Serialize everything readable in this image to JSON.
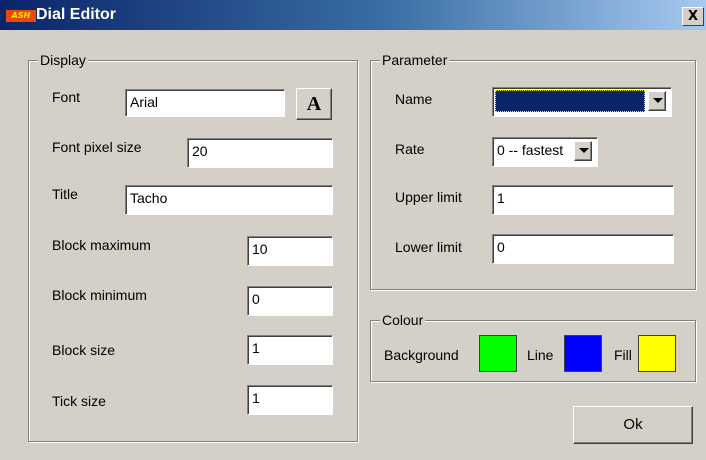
{
  "window": {
    "title": "Dial Editor",
    "logo_text": "ASH",
    "close_label": "X"
  },
  "display": {
    "legend": "Display",
    "font_label": "Font",
    "font_value": "Arial",
    "font_button_label": "A",
    "font_pixel_size_label": "Font pixel size",
    "font_pixel_size_value": "20",
    "title_label": "Title",
    "title_value": "Tacho",
    "block_maximum_label": "Block maximum",
    "block_maximum_value": "10",
    "block_minimum_label": "Block minimum",
    "block_minimum_value": "0",
    "block_size_label": "Block size",
    "block_size_value": "1",
    "tick_size_label": "Tick size",
    "tick_size_value": "1"
  },
  "parameter": {
    "legend": "Parameter",
    "name_label": "Name",
    "name_value": "",
    "rate_label": "Rate",
    "rate_value": "0 -- fastest",
    "upper_limit_label": "Upper limit",
    "upper_limit_value": "1",
    "lower_limit_label": "Lower limit",
    "lower_limit_value": "0"
  },
  "colour": {
    "legend": "Colour",
    "background_label": "Background",
    "background_color": "#00ff00",
    "line_label": "Line",
    "line_color": "#0000ff",
    "fill_label": "Fill",
    "fill_color": "#ffff00"
  },
  "ok_label": "Ok",
  "colors": {
    "titlebar_start": "#0a246a",
    "titlebar_end": "#a6caf0",
    "name_selection": "#0a246a",
    "dialog_face": "#d4d0c8"
  },
  "icons": {
    "close": "close-icon",
    "dropdown": "chevron-down-icon",
    "font_picker": "font-icon"
  }
}
